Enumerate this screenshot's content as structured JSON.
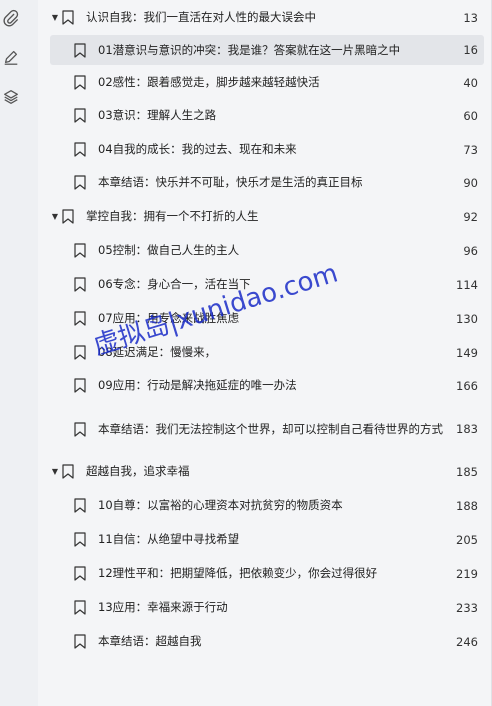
{
  "sidebar": {
    "icons": [
      {
        "name": "paperclip-icon"
      },
      {
        "name": "pen-icon"
      },
      {
        "name": "layers-icon"
      }
    ]
  },
  "toc": {
    "items": [
      {
        "level": 1,
        "label": "认识自我：我们一直活在对人性的最大误会中",
        "page": "13",
        "expanded": true
      },
      {
        "level": 2,
        "label": "01潜意识与意识的冲突：我是谁？答案就在这一片黑暗之中",
        "page": "16",
        "selected": true
      },
      {
        "level": 2,
        "label": "02感性：跟着感觉走，脚步越来越轻越快活",
        "page": "40"
      },
      {
        "level": 2,
        "label": "03意识：理解人生之路",
        "page": "60"
      },
      {
        "level": 2,
        "label": "04自我的成长：我的过去、现在和未来",
        "page": "73"
      },
      {
        "level": 2,
        "label": "本章结语：快乐并不可耻，快乐才是生活的真正目标",
        "page": "90"
      },
      {
        "level": 1,
        "label": "掌控自我：拥有一个不打折的人生",
        "page": "92",
        "expanded": true
      },
      {
        "level": 2,
        "label": "05控制：做自己人生的主人",
        "page": "96"
      },
      {
        "level": 2,
        "label": "06专念：身心合一，活在当下",
        "page": "114"
      },
      {
        "level": 2,
        "label": "07应用：用专念来战胜焦虑",
        "page": "130"
      },
      {
        "level": 2,
        "label": "08延迟满足：慢慢来，",
        "page": "149"
      },
      {
        "level": 2,
        "label": "09应用：行动是解决拖延症的唯一办法",
        "page": "166"
      },
      {
        "level": 2,
        "label": "本章结语：我们无法控制这个世界，却可以控制自己看待世界的方式",
        "page": "183"
      },
      {
        "level": 1,
        "label": "超越自我，追求幸福",
        "page": "185",
        "expanded": true
      },
      {
        "level": 2,
        "label": "10自尊：以富裕的心理资本对抗贫穷的物质资本",
        "page": "188"
      },
      {
        "level": 2,
        "label": "11自信：从绝望中寻找希望",
        "page": "205"
      },
      {
        "level": 2,
        "label": "12理性平和：把期望降低，把依赖变少，你会过得很好",
        "page": "219"
      },
      {
        "level": 2,
        "label": "13应用：幸福来源于行动",
        "page": "233"
      },
      {
        "level": 2,
        "label": "本章结语：超越自我",
        "page": "246"
      }
    ]
  },
  "watermark": "虚拟岛|xunidao.com",
  "colors": {
    "sidebar_bg": "#eef0f3",
    "toc_bg": "#f4f5f7",
    "selected_bg": "#e3e5e9",
    "watermark": "#1a2cc8"
  }
}
